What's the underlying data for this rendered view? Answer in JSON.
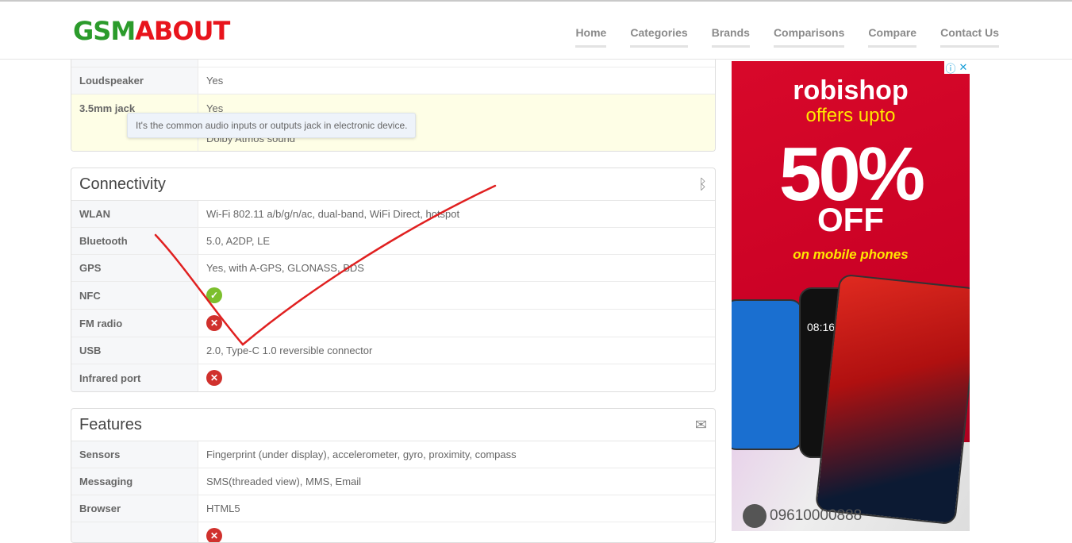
{
  "header": {
    "logo_green": "GSM",
    "logo_red": "ABOUT",
    "nav": [
      "Home",
      "Categories",
      "Brands",
      "Comparisons",
      "Compare",
      "Contact Us"
    ]
  },
  "sound": {
    "rows": [
      {
        "label": "Loudspeaker",
        "value": "Yes"
      },
      {
        "label": "3.5mm jack",
        "value": "Yes",
        "extra": "Dolby Atmos sound"
      }
    ],
    "tooltip": "It's the common audio inputs or outputs jack in electronic device."
  },
  "connectivity": {
    "title": "Connectivity",
    "icon": "bluetooth-icon",
    "rows": [
      {
        "label": "WLAN",
        "value": "Wi-Fi 802.11 a/b/g/n/ac, dual-band, WiFi Direct, hotspot"
      },
      {
        "label": "Bluetooth",
        "value": "5.0, A2DP, LE"
      },
      {
        "label": "GPS",
        "value": "Yes, with A-GPS, GLONASS, BDS"
      },
      {
        "label": "NFC",
        "value": "yes"
      },
      {
        "label": "FM radio",
        "value": "no"
      },
      {
        "label": "USB",
        "value": "2.0, Type-C 1.0 reversible connector"
      },
      {
        "label": "Infrared port",
        "value": "no"
      }
    ]
  },
  "features": {
    "title": "Features",
    "icon": "envelope-open-icon",
    "rows": [
      {
        "label": "Sensors",
        "value": "Fingerprint (under display), accelerometer, gyro, proximity, compass"
      },
      {
        "label": "Messaging",
        "value": "SMS(threaded view), MMS, Email"
      },
      {
        "label": "Browser",
        "value": "HTML5"
      }
    ]
  },
  "ad": {
    "brand": "robishop",
    "line1": "offers upto",
    "big": "50%",
    "off": "OFF",
    "line2": "on mobile phones",
    "phone": "09610000888",
    "clock": "08:16"
  },
  "colors": {
    "yes": "#7cbf2d",
    "no": "#d0312d",
    "annotation": "#e02020"
  }
}
